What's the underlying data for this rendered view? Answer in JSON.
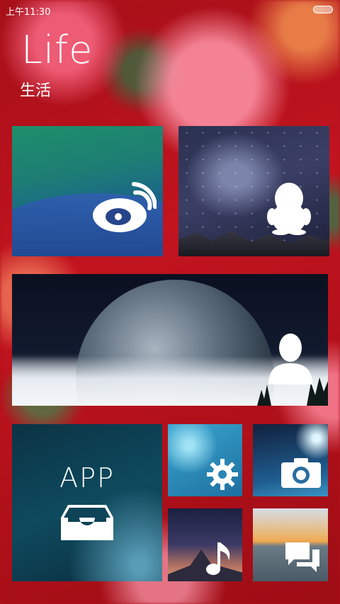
{
  "status_bar": {
    "time": "上午11:30"
  },
  "header": {
    "title": "Life",
    "subtitle": "生活"
  },
  "tiles": {
    "weibo": {
      "icon": "weibo-icon"
    },
    "qq": {
      "icon": "qq-penguin-icon"
    },
    "contact": {
      "icon": "person-icon"
    },
    "app": {
      "label": "APP",
      "icon": "inbox-tray-icon"
    },
    "settings": {
      "icon": "gear-icon"
    },
    "camera": {
      "icon": "camera-icon"
    },
    "music": {
      "icon": "music-note-icon"
    },
    "messages": {
      "icon": "chat-bubbles-icon"
    }
  }
}
